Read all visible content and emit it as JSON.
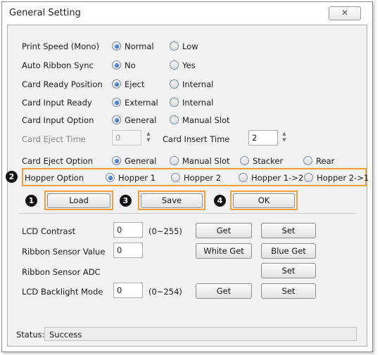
{
  "window": {
    "title": "General Setting",
    "close_icon": "close-icon"
  },
  "settings": {
    "print_speed": {
      "label": "Print Speed (Mono)",
      "options": [
        "Normal",
        "Low"
      ],
      "selected": "Normal"
    },
    "auto_ribbon_sync": {
      "label": "Auto Ribbon Sync",
      "options": [
        "No",
        "Yes"
      ],
      "selected": "No"
    },
    "card_ready_position": {
      "label": "Card Ready Position",
      "options": [
        "Eject",
        "Internal"
      ],
      "selected": "Eject"
    },
    "card_input_ready": {
      "label": "Card Input Ready",
      "options": [
        "External",
        "Internal"
      ],
      "selected": "External"
    },
    "card_input_option": {
      "label": "Card Input Option",
      "options": [
        "General",
        "Manual Slot"
      ],
      "selected": "General"
    },
    "card_eject_time": {
      "label": "Card Eject Time",
      "value": "0"
    },
    "card_insert_time": {
      "label": "Card Insert Time",
      "value": "2"
    },
    "card_eject_option": {
      "label": "Card Eject Option",
      "options": [
        "General",
        "Manual Slot",
        "Stacker",
        "Rear"
      ],
      "selected": "General"
    },
    "hopper_option": {
      "label": "Hopper Option",
      "options": [
        "Hopper 1",
        "Hopper 2",
        "Hopper 1->2",
        "Hopper 2->1"
      ],
      "selected": "Hopper 1"
    }
  },
  "buttons": {
    "load": "Load",
    "save": "Save",
    "ok": "OK"
  },
  "badges": {
    "load": "1",
    "hopper": "2",
    "save": "3",
    "ok": "4"
  },
  "lcd": {
    "contrast": {
      "label": "LCD Contrast",
      "value": "0",
      "range": "(0~255)",
      "get": "Get",
      "set": "Set"
    },
    "ribbon_sensor_value": {
      "label": "Ribbon Sensor Value",
      "value": "0",
      "white_get": "White Get",
      "blue_get": "Blue Get"
    },
    "ribbon_sensor_adc": {
      "label": "Ribbon Sensor ADC",
      "set": "Set"
    },
    "backlight": {
      "label": "LCD Backlight Mode",
      "value": "0",
      "range": "(0~254)",
      "get": "Get",
      "set": "Set"
    }
  },
  "status": {
    "label": "Status:",
    "value": "Success"
  },
  "colors": {
    "highlight": "#f0a040",
    "radio_selected": "#1b4fb0"
  }
}
